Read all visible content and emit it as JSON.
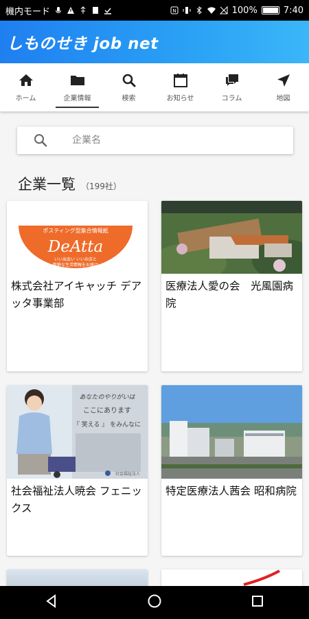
{
  "status_bar": {
    "left_text": "機内モード",
    "battery": "100%",
    "time": "7:40"
  },
  "app": {
    "title": "しものせき job net"
  },
  "tabs": [
    {
      "label": "ホーム",
      "icon": "home-icon"
    },
    {
      "label": "企業情報",
      "icon": "folder-icon"
    },
    {
      "label": "検索",
      "icon": "search-icon"
    },
    {
      "label": "お知らせ",
      "icon": "calendar-icon"
    },
    {
      "label": "コラム",
      "icon": "chat-icon"
    },
    {
      "label": "地図",
      "icon": "navigation-icon"
    }
  ],
  "search": {
    "placeholder": "企業名"
  },
  "section": {
    "title": "企業一覧",
    "count": "（199社）"
  },
  "companies": [
    {
      "name": "株式会社アイキャッチ デアッタ事業部",
      "image": "deatta-logo"
    },
    {
      "name": "医療法人愛の会　光風園病院",
      "image": "hospital-aerial-photo"
    },
    {
      "name": "社会福祉法人暁会 フェニックス",
      "image": "care-worker-photo"
    },
    {
      "name": "特定医療法人茜会 昭和病院",
      "image": "hospital-buildings-photo"
    }
  ],
  "logo": {
    "banner": "ポスティング型集合情報紙",
    "word": "DeAtta",
    "tagline1": "いい出会い いいお店と",
    "tagline2": "新鮮な生活情報をお届け"
  },
  "promo": {
    "line1": "あなたのやりがいは",
    "line2": "ここにあります",
    "line3": "『 笑える 』 をみんなに",
    "line4": "社会福祉法人"
  },
  "colors": {
    "header_start": "#1f7ff0",
    "header_end": "#3bb6f8",
    "logo_orange": "#ee6b2a"
  }
}
